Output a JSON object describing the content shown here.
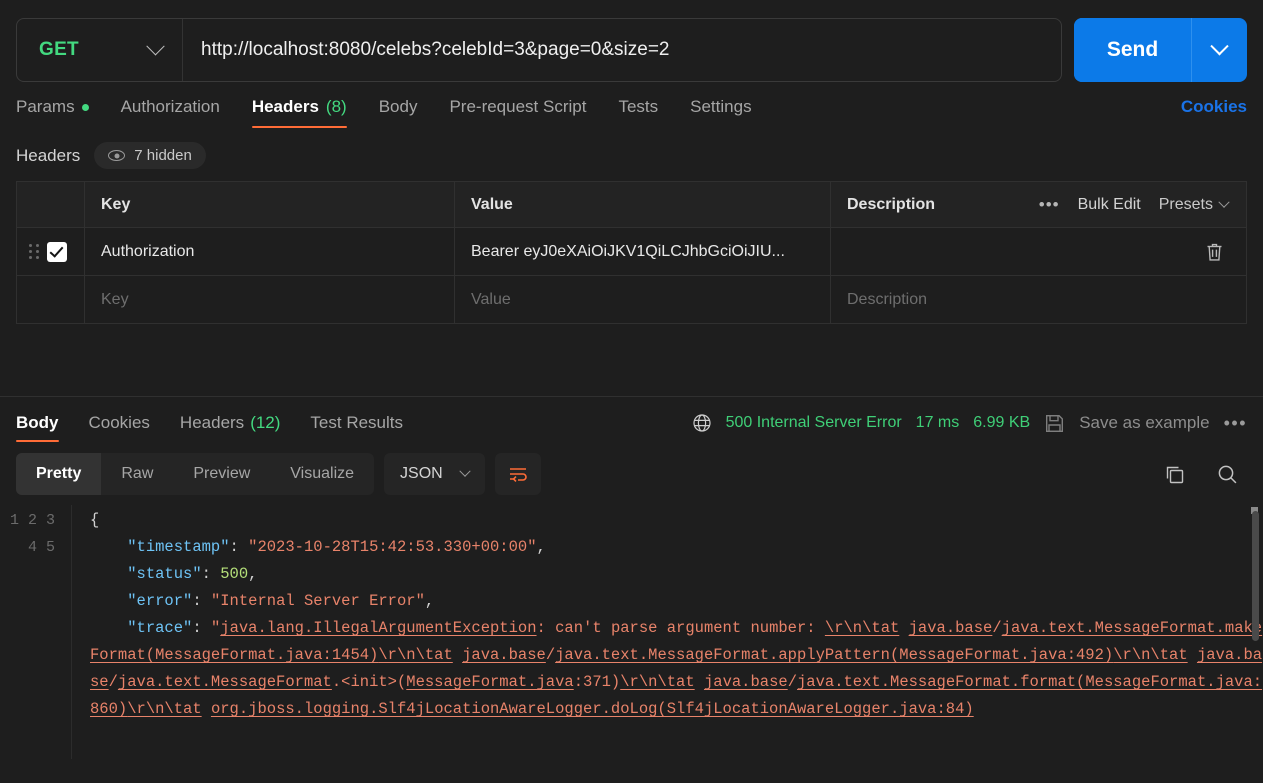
{
  "request": {
    "method": "GET",
    "url": "http://localhost:8080/celebs?celebId=3&page=0&size=2",
    "send_label": "Send",
    "tabs": [
      {
        "label": "Params",
        "dot": true,
        "count": "",
        "active": false
      },
      {
        "label": "Authorization",
        "dot": false,
        "count": "",
        "active": false
      },
      {
        "label": "Headers",
        "dot": false,
        "count": "(8)",
        "active": true
      },
      {
        "label": "Body",
        "dot": false,
        "count": "",
        "active": false
      },
      {
        "label": "Pre-request Script",
        "dot": false,
        "count": "",
        "active": false
      },
      {
        "label": "Tests",
        "dot": false,
        "count": "",
        "active": false
      },
      {
        "label": "Settings",
        "dot": false,
        "count": "",
        "active": false
      }
    ],
    "cookies_link": "Cookies"
  },
  "headers_panel": {
    "title": "Headers",
    "hidden_label": "7 hidden",
    "columns": {
      "key": "Key",
      "value": "Value",
      "description": "Description"
    },
    "actions": {
      "more": "•••",
      "bulk_edit": "Bulk Edit",
      "presets": "Presets"
    },
    "rows": [
      {
        "checked": true,
        "key": "Authorization",
        "value": "Bearer eyJ0eXAiOiJKV1QiLCJhbGciOiJIU...",
        "description": ""
      }
    ],
    "placeholders": {
      "key": "Key",
      "value": "Value",
      "description": "Description"
    }
  },
  "response": {
    "tabs": [
      {
        "label": "Body",
        "count": "",
        "active": true
      },
      {
        "label": "Cookies",
        "count": "",
        "active": false
      },
      {
        "label": "Headers",
        "count": "(12)",
        "active": false
      },
      {
        "label": "Test Results",
        "count": "",
        "active": false
      }
    ],
    "status": "500 Internal Server Error",
    "time": "17 ms",
    "size": "6.99 KB",
    "save_as_example": "Save as example",
    "more": "•••",
    "view_modes": [
      {
        "label": "Pretty",
        "active": true
      },
      {
        "label": "Raw",
        "active": false
      },
      {
        "label": "Preview",
        "active": false
      },
      {
        "label": "Visualize",
        "active": false
      }
    ],
    "format": "JSON"
  },
  "body": {
    "lines": [
      "1",
      "2",
      "3",
      "4",
      "5"
    ],
    "json": {
      "timestamp": "2023-10-28T15:42:53.330+00:00",
      "status": 500,
      "error": "Internal Server Error",
      "trace": "java.lang.IllegalArgumentException: can't parse argument number: \\r\\n\\tat java.base/java.text.MessageFormat.makeFormat(MessageFormat.java:1454)\\r\\n\\tat java.base/java.text.MessageFormat.applyPattern(MessageFormat.java:492)\\r\\n\\tat java.base/java.text.MessageFormat.<init>(MessageFormat.java:371)\\r\\n\\tat java.base/java.text.MessageFormat.format(MessageFormat.java:860)\\r\\n\\tat org.jboss.logging.Slf4jLocationAwareLogger.doLog(Slf4jLocationAwareLogger.java:84)"
    }
  },
  "colors": {
    "accent": "#ff6c37",
    "send": "#0c7ae8",
    "method": "#43d980",
    "status": "#3fcf77",
    "link": "#1a73e8"
  }
}
